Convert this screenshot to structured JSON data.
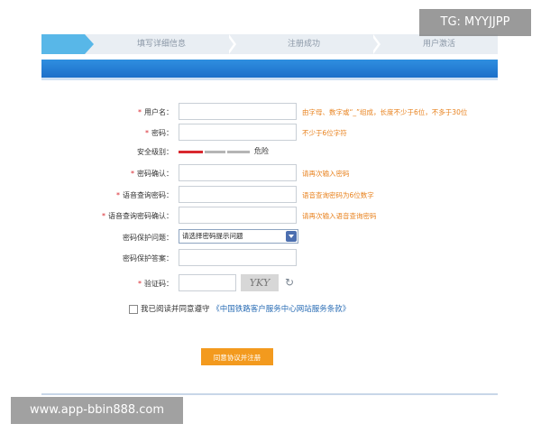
{
  "steps": [
    "填写详细信息",
    "注册成功",
    "用户激活"
  ],
  "form": {
    "username": {
      "label": "用户名：",
      "hint": "由字母、数字或“_”组成，长度不少于6位，不多于30位"
    },
    "password": {
      "label": "密码：",
      "hint": "不少于6位字符"
    },
    "security": {
      "label": "安全级别：",
      "level_text": "危险",
      "level_fraction": 0.33
    },
    "password_confirm": {
      "label": "密码确认：",
      "hint": "请再次输入密码"
    },
    "voice_password": {
      "label": "语音查询密码：",
      "hint": "语音查询密码为6位数字"
    },
    "voice_password_confirm": {
      "label": "语音查询密码确认：",
      "hint": "请再次输入语音查询密码"
    },
    "security_question": {
      "label": "密码保护问题：",
      "selected": "请选择密码提示问题"
    },
    "security_answer": {
      "label": "密码保护答案："
    },
    "captcha": {
      "label": "验证码：",
      "image_text": "YKY"
    }
  },
  "agreement": {
    "prefix": "我已阅读并同意遵守",
    "link": "《中国铁路客户服务中心网站服务条款》"
  },
  "submit_label": "同意协议并注册",
  "watermarks": {
    "tg": "TG: MYYJJPP",
    "url": "www.app-bbin888.com"
  },
  "colors": {
    "accent_blue": "#1c6fc9",
    "hint_orange": "#e8821e",
    "button_orange": "#f39a1e",
    "danger_red": "#d9282f"
  }
}
